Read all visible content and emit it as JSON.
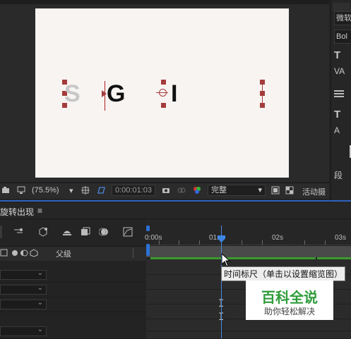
{
  "viewer": {
    "letters": [
      "S",
      "G",
      "I"
    ],
    "footer": {
      "zoom": "(75.5%)",
      "timecode": "0:00:01:03",
      "quality": "完整",
      "camera_label": "活动摄"
    }
  },
  "right_panel": {
    "font_family": "微软",
    "font_style": "Bol",
    "paragraph": "段"
  },
  "timeline": {
    "tab_title": "旋转出现",
    "menu_glyph": "≡",
    "parent_column": "父级",
    "ruler_ticks": [
      "0:00s",
      "01s",
      "02s",
      "03s"
    ],
    "tooltip": "时间标尺（单击以设置缩览图）"
  },
  "watermark": {
    "title": "百科全说",
    "subtitle": "助你轻松解决"
  },
  "colors": {
    "accent_blue": "#3d86e6",
    "handle_red": "#a43c3c",
    "green_bar": "#3a9a2e"
  }
}
